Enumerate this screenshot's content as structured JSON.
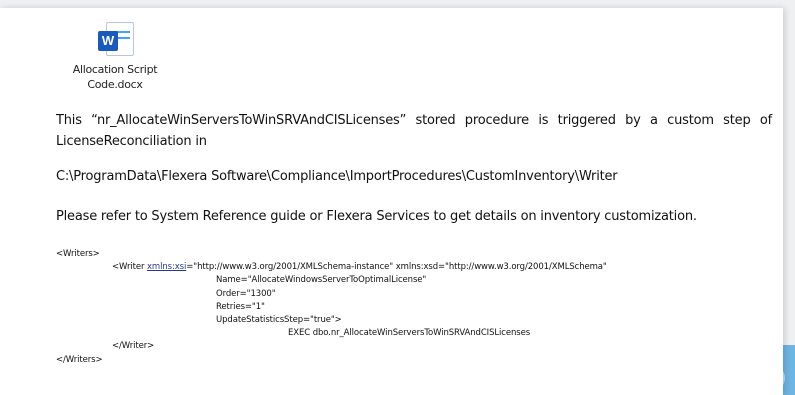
{
  "attachment": {
    "icon": "word-docx-icon",
    "icon_letter": "W",
    "name_line1": "Allocation Script",
    "name_line2": "Code.docx"
  },
  "paragraphs": {
    "p1": "This “nr_AllocateWinServersToWinSRVAndCISLicenses” stored procedure is triggered by a custom step of LicenseReconciliation in",
    "p2": "C:\\ProgramData\\Flexera Software\\Compliance\\ImportProcedures\\CustomInventory\\Writer",
    "p3": "Please refer to System Reference guide or Flexera Services to get details on inventory customization."
  },
  "xml": {
    "writers_open": "<Writers>",
    "writer_prefix": "<Writer ",
    "writer_xsi_attr": "xmlns:xsi",
    "writer_rest": "=\"http://www.w3.org/2001/XMLSchema-instance\" xmlns:xsd=\"http://www.w3.org/2001/XMLSchema\"",
    "name_attr": "Name=\"AllocateWindowsServerToOptimalLicense\"",
    "order_attr": "Order=\"1300\"",
    "retries_attr": "Retries=\"1\"",
    "update_attr": "UpdateStatisticsStep=\"true\">",
    "exec_line": "EXEC dbo.nr_AllocateWinServersToWinSRVAndCISLicenses",
    "writer_close": "</Writer>",
    "writers_close": "</Writers>"
  },
  "colors": {
    "word_blue": "#185abd",
    "background_band": "#2a93d8"
  }
}
